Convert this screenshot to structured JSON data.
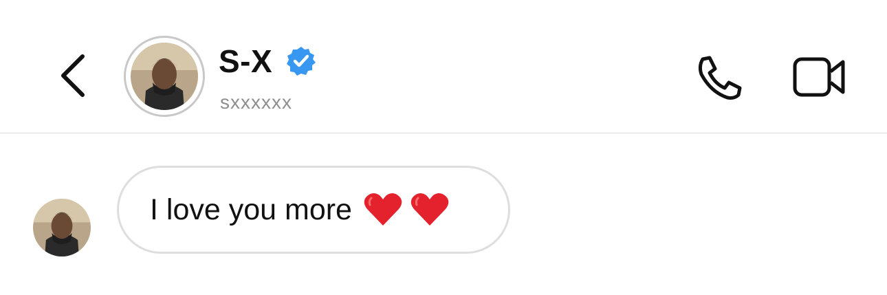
{
  "header": {
    "back_icon": "chevron-left-icon",
    "name": "S-X",
    "verified_icon": "verified-badge-icon",
    "username": "sxxxxxx",
    "call_icon": "phone-icon",
    "video_icon": "video-camera-icon",
    "verified_color": "#3897f0"
  },
  "messages": [
    {
      "text": "I love you more",
      "emoji_icons": [
        "red-heart-icon",
        "red-heart-icon"
      ],
      "emoji_color": "#e3222d"
    }
  ]
}
